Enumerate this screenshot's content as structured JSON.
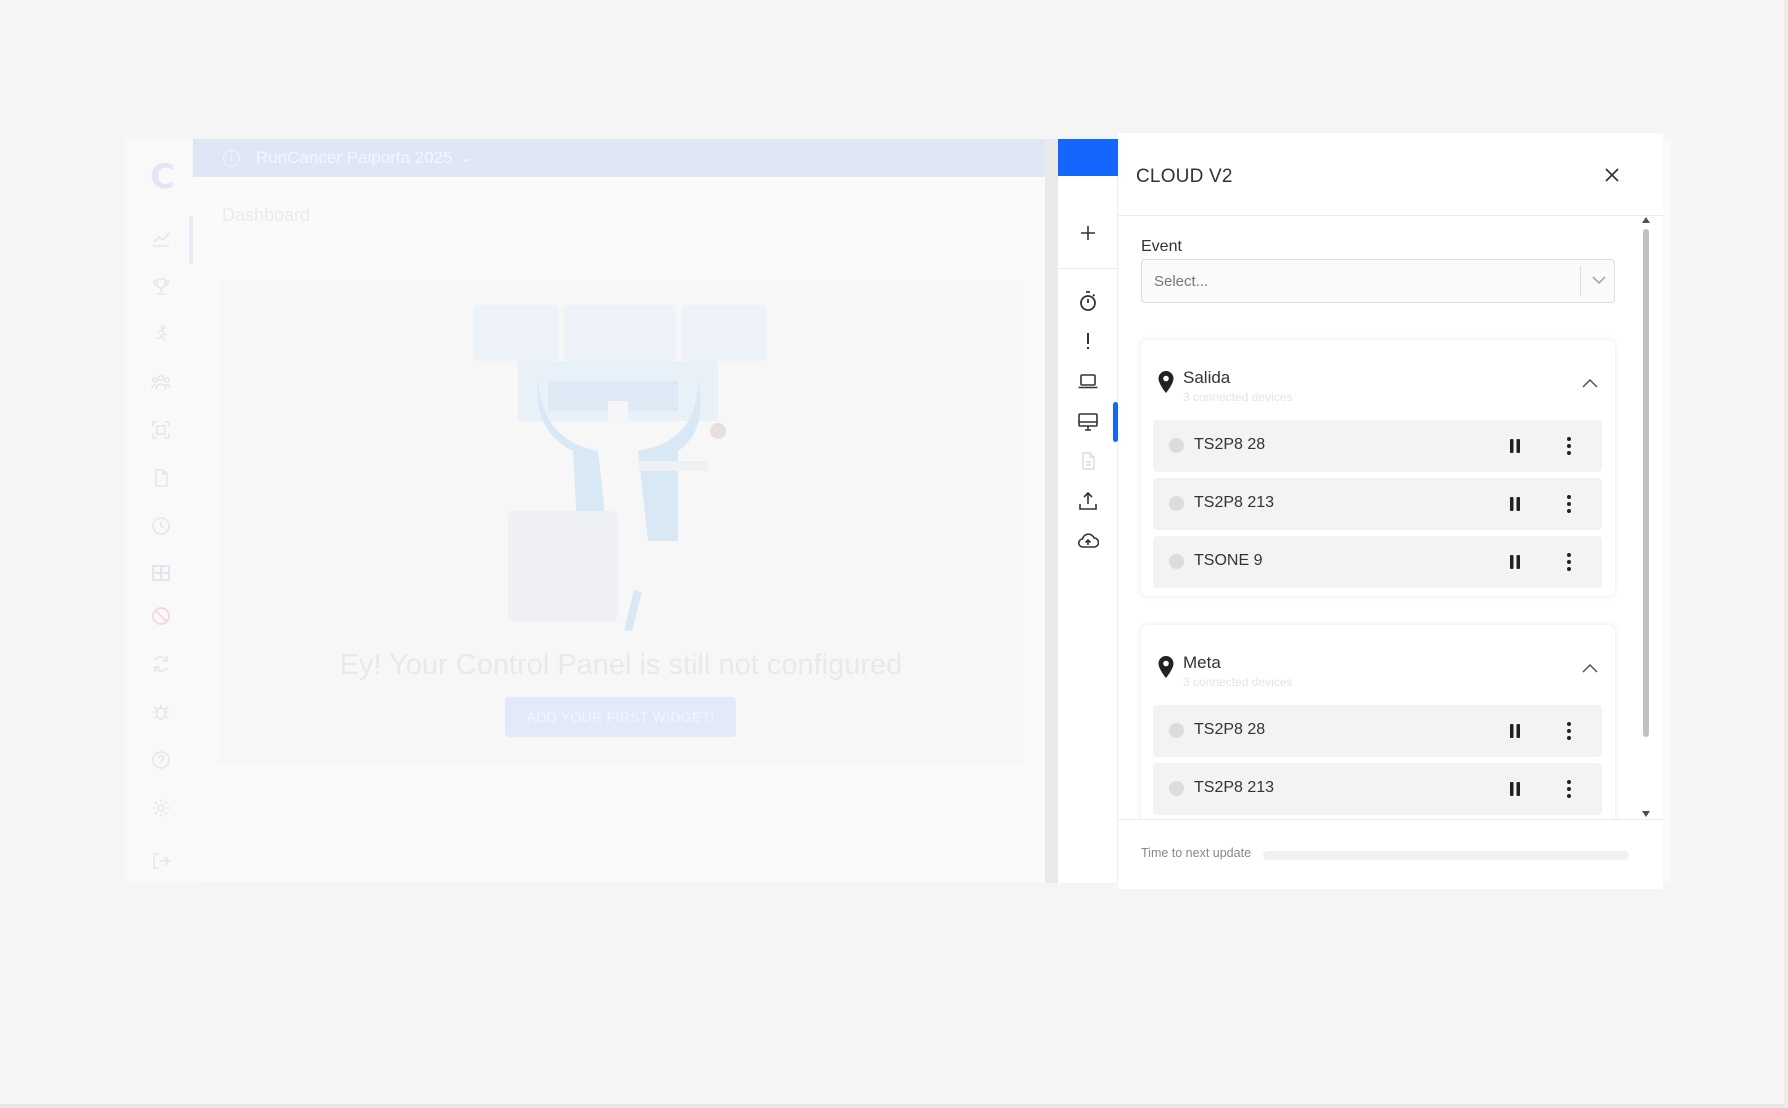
{
  "app": {
    "logo_letter": "C",
    "event_name": "RunCancer Paiporta 2025",
    "page_title": "Dashboard",
    "empty_message": "Ey! Your Control Panel is still not configured",
    "add_widget_label": "ADD YOUR FIRST WIDGET!"
  },
  "rail_icons": [
    "chart-icon",
    "trophy-icon",
    "runner-icon",
    "group-icon",
    "scan-icon",
    "file-icon",
    "clock-icon",
    "grid-icon",
    "ban-icon",
    "refresh-icon",
    "bug-icon",
    "help-icon",
    "settings-icon",
    "logout-icon"
  ],
  "tools": [
    {
      "name": "add-tool-icon",
      "glyph": "+"
    },
    {
      "name": "stopwatch-tool-icon"
    },
    {
      "name": "alert-tool-icon",
      "glyph": "!"
    },
    {
      "name": "laptop-tool-icon"
    },
    {
      "name": "monitor-tool-icon"
    },
    {
      "name": "document-tool-icon"
    },
    {
      "name": "upload-tool-icon"
    },
    {
      "name": "cloud-upload-tool-icon"
    }
  ],
  "panel": {
    "title": "CLOUD V2",
    "event_label": "Event",
    "event_placeholder": "Select...",
    "groups": [
      {
        "name": "Salida",
        "subtitle": "3 connected devices",
        "devices": [
          {
            "name": "TS2P8 28"
          },
          {
            "name": "TS2P8 213"
          },
          {
            "name": "TSONE 9"
          }
        ]
      },
      {
        "name": "Meta",
        "subtitle": "3 connected devices",
        "devices": [
          {
            "name": "TS2P8 28"
          },
          {
            "name": "TS2P8 213"
          }
        ]
      }
    ],
    "update_label": "Time to next update",
    "update_progress": 0.0
  },
  "colors": {
    "accent": "#1565ff",
    "device_bg": "#f3f3f3",
    "status_dot": "#dcdcdc"
  }
}
